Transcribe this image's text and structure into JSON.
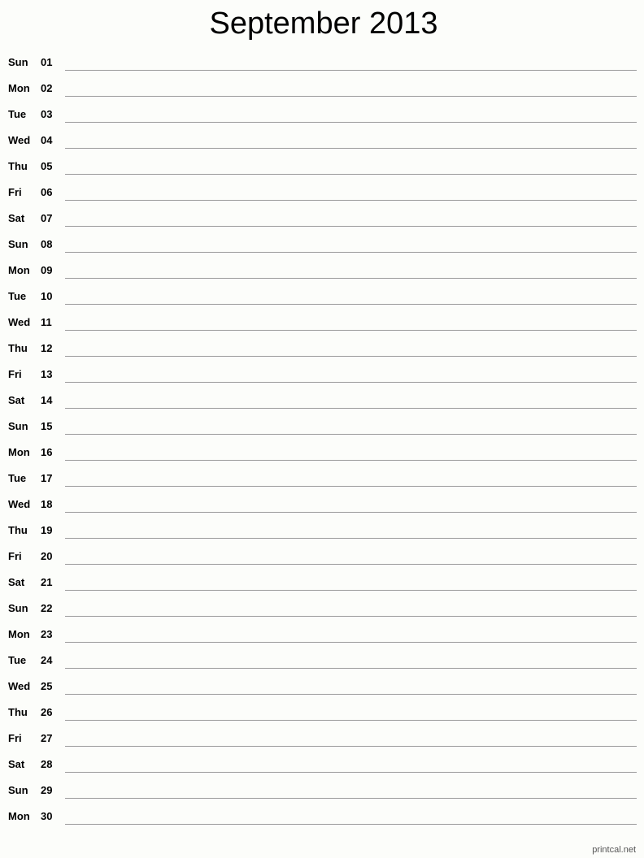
{
  "title": "September 2013",
  "days": [
    {
      "dow": "Sun",
      "day": "01"
    },
    {
      "dow": "Mon",
      "day": "02"
    },
    {
      "dow": "Tue",
      "day": "03"
    },
    {
      "dow": "Wed",
      "day": "04"
    },
    {
      "dow": "Thu",
      "day": "05"
    },
    {
      "dow": "Fri",
      "day": "06"
    },
    {
      "dow": "Sat",
      "day": "07"
    },
    {
      "dow": "Sun",
      "day": "08"
    },
    {
      "dow": "Mon",
      "day": "09"
    },
    {
      "dow": "Tue",
      "day": "10"
    },
    {
      "dow": "Wed",
      "day": "11"
    },
    {
      "dow": "Thu",
      "day": "12"
    },
    {
      "dow": "Fri",
      "day": "13"
    },
    {
      "dow": "Sat",
      "day": "14"
    },
    {
      "dow": "Sun",
      "day": "15"
    },
    {
      "dow": "Mon",
      "day": "16"
    },
    {
      "dow": "Tue",
      "day": "17"
    },
    {
      "dow": "Wed",
      "day": "18"
    },
    {
      "dow": "Thu",
      "day": "19"
    },
    {
      "dow": "Fri",
      "day": "20"
    },
    {
      "dow": "Sat",
      "day": "21"
    },
    {
      "dow": "Sun",
      "day": "22"
    },
    {
      "dow": "Mon",
      "day": "23"
    },
    {
      "dow": "Tue",
      "day": "24"
    },
    {
      "dow": "Wed",
      "day": "25"
    },
    {
      "dow": "Thu",
      "day": "26"
    },
    {
      "dow": "Fri",
      "day": "27"
    },
    {
      "dow": "Sat",
      "day": "28"
    },
    {
      "dow": "Sun",
      "day": "29"
    },
    {
      "dow": "Mon",
      "day": "30"
    }
  ],
  "footer": "printcal.net",
  "colors": {
    "background": "#fcfdfa",
    "line": "#999999",
    "text": "#000000"
  }
}
